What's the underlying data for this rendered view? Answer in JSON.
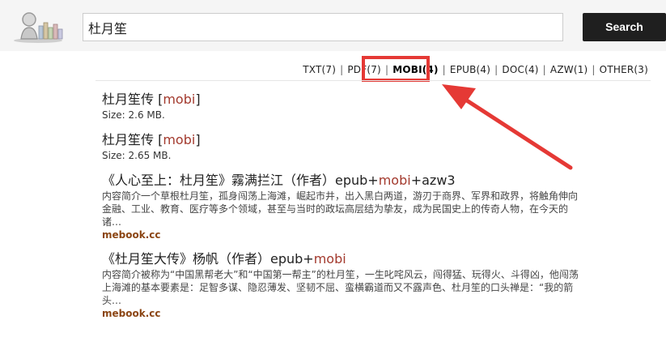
{
  "search": {
    "query": "杜月笙",
    "button_label": "Search"
  },
  "filters": [
    {
      "label": "TXT(7)",
      "active": false
    },
    {
      "label": "PDF(7)",
      "active": false
    },
    {
      "label": "MOBI(4)",
      "active": true
    },
    {
      "label": "EPUB(4)",
      "active": false
    },
    {
      "label": "DOC(4)",
      "active": false
    },
    {
      "label": "AZW(1)",
      "active": false
    },
    {
      "label": "OTHER(3)",
      "active": false
    }
  ],
  "results": [
    {
      "title_prefix": "杜月笙传 [",
      "format": "mobi",
      "title_suffix": "]",
      "size": "Size: 2.6 MB."
    },
    {
      "title_prefix": "杜月笙传 [",
      "format": "mobi",
      "title_suffix": "]",
      "size": "Size: 2.65 MB."
    },
    {
      "title_prefix": "《人心至上：杜月笙》霧满拦江（作者）epub+",
      "format": "mobi",
      "title_suffix": "+azw3",
      "description": "内容简介一个草根杜月笙，孤身闯荡上海滩，崛起市井，出入黑白两道，游刃于商界、军界和政界，将触角伸向金融、工业、教育、医疗等多个领域，甚至与当时的政坛高层结为挚友，成为民国史上的传奇人物，在今天的诸…",
      "source": "mebook.cc"
    },
    {
      "title_prefix": "《杜月笙大传》杨帆（作者）epub+",
      "format": "mobi",
      "title_suffix": "",
      "description": "内容简介被称为“中国黑帮老大”和“中国第一帮主”的杜月笙，一生叱咤风云，闯得猛、玩得火、斗得凶，他闯荡上海滩的基本要素是：足智多谋、隐忍薄发、坚韧不屈、蛮横霸道而又不露声色、杜月笙的口头禅是：“我的箭头…",
      "source": "mebook.cc"
    }
  ],
  "colors": {
    "highlight_box": "#e53935",
    "format_link": "#a33a2e",
    "source": "#8b4513",
    "search_button": "#1f1f1f"
  }
}
